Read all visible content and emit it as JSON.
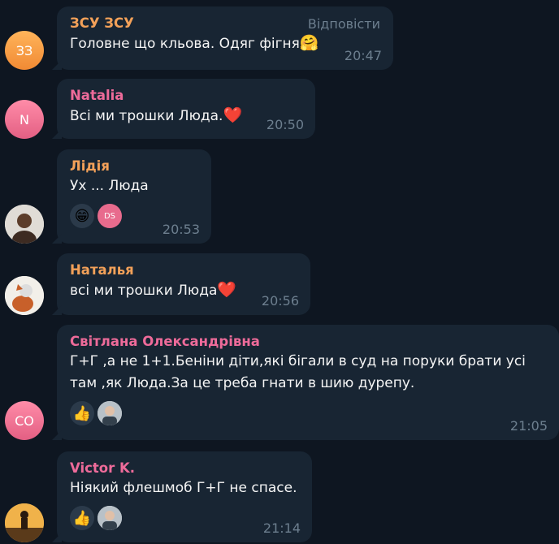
{
  "messages": [
    {
      "name": "ЗСУ ЗСУ",
      "avatar": "ЗЗ",
      "text": "Головне що кльова. Одяг фігня",
      "emoji": "🤗",
      "time": "20:47",
      "reply": "Відповісти"
    },
    {
      "name": "Natalia",
      "avatar": "N",
      "text": "Всі ми трошки Люда.",
      "emoji": "❤️",
      "time": "20:50"
    },
    {
      "name": "Лідія",
      "text": "Ух ... Люда",
      "time": "20:53",
      "reactions": [
        "😁",
        "DS"
      ]
    },
    {
      "name": "Наталья",
      "text": "всі ми трошки Люда",
      "emoji": "❤️",
      "time": "20:56"
    },
    {
      "name": "Світлана Олександрівна",
      "avatar": "СО",
      "text_line1": "Г+Г ,а не 1+1.Беніни діти,які бігали в суд на поруки брати усі",
      "text_line2": "там ,як Люда.За це треба гнати в шию дурепу.",
      "time": "21:05",
      "reactions": [
        "👍"
      ]
    },
    {
      "name": "Victor K.",
      "text": "Ніякий флешмоб Г+Г не спасе.",
      "time": "21:14",
      "reactions": [
        "👍"
      ]
    }
  ],
  "colors": {
    "background": "#0e1621",
    "bubble": "#182533",
    "time": "#6d7f8f",
    "name_orange": "#f3a159",
    "name_pink": "#ee6b9a"
  }
}
